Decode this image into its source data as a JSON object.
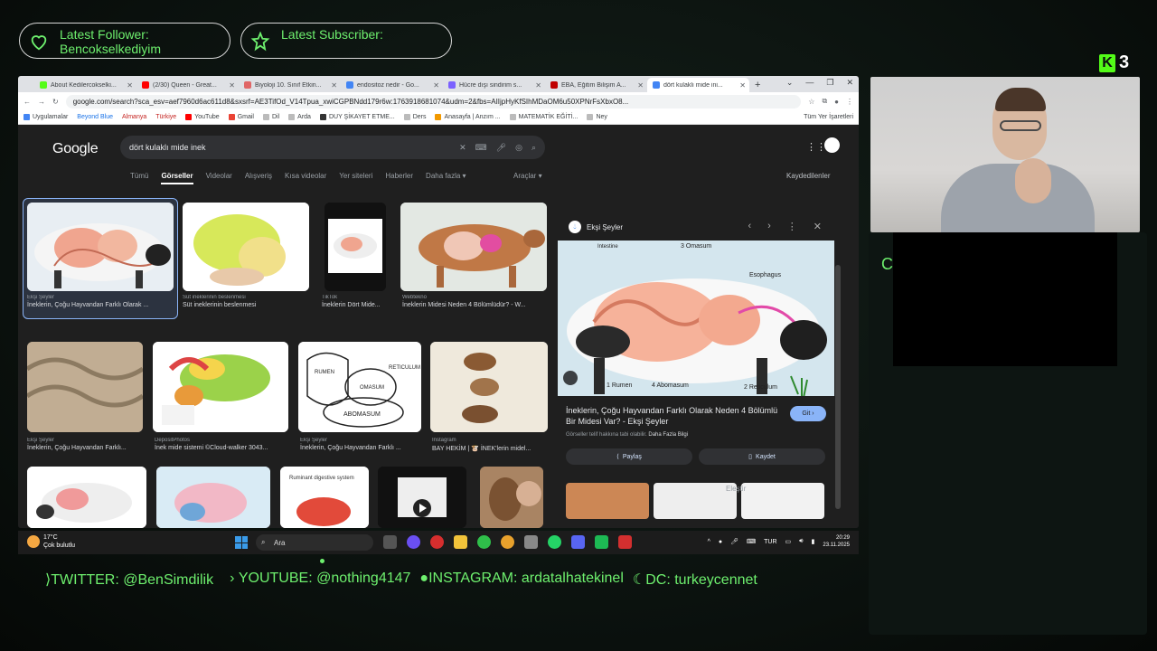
{
  "overlay": {
    "follower_label": "Latest Follower:",
    "follower_name": "Bencokselkediyim",
    "subscriber_label": "Latest Subscriber:",
    "kick_count": "3",
    "kick_letter": "K",
    "side_letter": "C",
    "accent": "#6ef06e"
  },
  "browser": {
    "tabs": [
      {
        "label": "About Kedilercokselki...",
        "color": "#53fc18"
      },
      {
        "label": "(2/30) Queen - Great...",
        "color": "#ff0000"
      },
      {
        "label": "Biyoloji 10. Sınıf Etkin...",
        "color": "#e06666"
      },
      {
        "label": "endositoz nedir - Go...",
        "color": "#4285f4"
      },
      {
        "label": "Hücre dışı sindirim s...",
        "color": "#7b61ff"
      },
      {
        "label": "EBA, Eğitim Bilişim A...",
        "color": "#c00000"
      },
      {
        "label": "dört kulaklı mide ini...",
        "color": "#4285f4"
      }
    ],
    "url": "google.com/search?sca_esv=aef7960d6ac611d8&sxsrf=AE3TifOd_V14Tpua_xwiCGPBNdd179r6w:1763918681074&udm=2&fbs=AIIjpHyKfSIhMDaOM6u50XPNrFsXbxO8...",
    "bookmarks": [
      "Uygulamalar",
      "Beyond Blue",
      "Almanya",
      "Türkiye",
      "YouTube",
      "Gmail",
      "Dil",
      "Arda",
      "DUY ŞİKAYET ETME...",
      "Ders",
      "Anasayfa | Anzım ...",
      "MATEMATİK EĞİTİ...",
      "Ney"
    ],
    "bookmarks_right": "Tüm Yer İşaretleri"
  },
  "google": {
    "logo": "Google",
    "query": "dört kulaklı mide inek",
    "tabs": [
      "Tümü",
      "Görseller",
      "Videolar",
      "Alışveriş",
      "Kısa videolar",
      "Yer siteleri",
      "Haberler",
      "Daha fazla ▾"
    ],
    "tools": "Araçlar ▾",
    "saved": "Kaydedilenler",
    "results": [
      {
        "src": "Ekşi Şeyler",
        "title": "İneklerin, Çoğu Hayvandan Farklı Olarak ..."
      },
      {
        "src": "Süt ineklerinin beslenmesi",
        "title": "Süt ineklerinin beslenmesi"
      },
      {
        "src": "TikTok",
        "title": "İneklerin Dört Mide..."
      },
      {
        "src": "Webtekno",
        "title": "İneklerin Midesi Neden 4 Bölümlüdür? - W..."
      },
      {
        "src": "Ekşi Şeyler",
        "title": "İneklerin, Çoğu Hayvandan Farklı..."
      },
      {
        "src": "DepositPhotos",
        "title": "İnek mide sistemi ©Cloud-walker 3043..."
      },
      {
        "src": "Ekşi Şeyler",
        "title": "İneklerin, Çoğu Hayvandan Farklı ..."
      },
      {
        "src": "Instagram",
        "title": "BAY HEKİM | 🐮 İNEK'lerin midel..."
      }
    ],
    "diagram_labels": {
      "rumen": "RUMEN",
      "omasum": "OMASUM",
      "abomasum": "ABOMASUM",
      "reticulum": "RETICULUM",
      "digestive": "Ruminant digestive system"
    },
    "preview": {
      "source": "Ekşi Şeyler",
      "title": "İneklerin, Çoğu Hayvandan Farklı Olarak Neden 4 Bölümlü Bir Midesi Var? - Ekşi Şeyler",
      "go": "Git ›",
      "note": "Görseller telif hakkına tabi olabilir.",
      "note_link": "Daha Fazla Bilgi",
      "share": "Paylaş",
      "save": "Kaydet",
      "labels": {
        "intestine": "Intestine",
        "omasum": "3 Omasum",
        "esophagus": "Esophagus",
        "rumen": "1 Rumen",
        "abomasum": "4 Abomasum",
        "reticulum": "2 Reticulum"
      },
      "feedback": "Eleştir"
    }
  },
  "taskbar": {
    "temp": "17°C",
    "weather": "Çok bulutlu",
    "search": "Ara",
    "lang": "TUR",
    "time": "20:29",
    "date": "23.11.2025"
  },
  "social": {
    "twitter": "TWITTER: @BenSimdilik",
    "youtube": "YOUTUBE: @nothing4147",
    "instagram": "INSTAGRAM: ardatalhatekinel",
    "dc": "DC: turkeycennet"
  }
}
